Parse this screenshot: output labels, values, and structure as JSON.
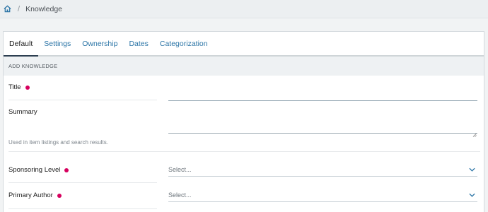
{
  "breadcrumb": {
    "home_icon": "home-icon",
    "separator": "/",
    "current": "Knowledge"
  },
  "tabs": [
    {
      "label": "Default",
      "active": true
    },
    {
      "label": "Settings",
      "active": false
    },
    {
      "label": "Ownership",
      "active": false
    },
    {
      "label": "Dates",
      "active": false
    },
    {
      "label": "Categorization",
      "active": false
    }
  ],
  "section": {
    "title": "ADD KNOWLEDGE"
  },
  "form": {
    "title": {
      "label": "Title",
      "required": true,
      "value": ""
    },
    "summary": {
      "label": "Summary",
      "required": false,
      "value": "",
      "help": "Used in item listings and search results."
    },
    "sponsoring_level": {
      "label": "Sponsoring Level",
      "required": true,
      "value": "Select..."
    },
    "primary_author": {
      "label": "Primary Author",
      "required": true,
      "value": "Select..."
    }
  },
  "colors": {
    "accent": "#2a74a6",
    "required_dot": "#d6005e",
    "section_bg": "#eef1f3"
  }
}
